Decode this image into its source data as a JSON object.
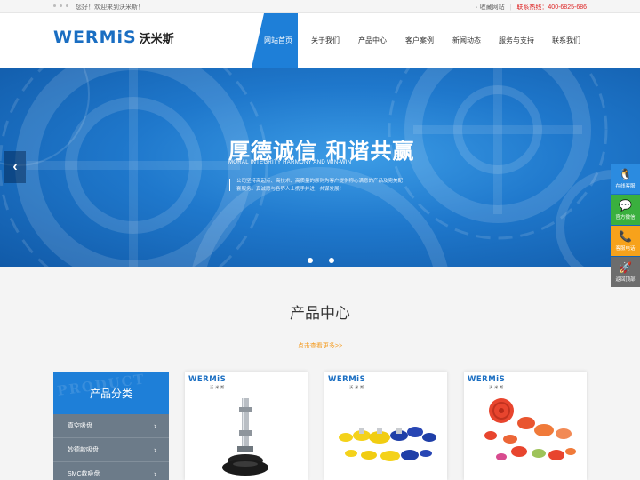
{
  "topbar": {
    "welcome": "您好！欢迎来到沃米斯！",
    "favorite": "收藏网站",
    "hotline_label": "联系热线：",
    "hotline": "400-6825-686"
  },
  "header": {
    "logo_latin": "WERMiS",
    "logo_cn": "沃米斯",
    "nav": [
      {
        "label": "网站首页",
        "active": true
      },
      {
        "label": "关于我们"
      },
      {
        "label": "产品中心"
      },
      {
        "label": "客户案例"
      },
      {
        "label": "新闻动态"
      },
      {
        "label": "服务与支持"
      },
      {
        "label": "联系我们"
      }
    ]
  },
  "banner": {
    "title": "厚德诚信  和谐共赢",
    "subtitle": "MORAL INTEGRITY HARMONY AND WIN-WIN",
    "description": "公司坚持高起点、高技术、高质量的原则为客户提供称心满意的产品及完美配套服务。真诚愿与各界人士携手并进，共谋发展！",
    "prev_arrow": "‹",
    "dots": 2
  },
  "sidebar_float": [
    {
      "icon": "qq-icon",
      "glyph": "🐧",
      "label": "在线客服"
    },
    {
      "icon": "wechat-icon",
      "glyph": "💬",
      "label": "官方微信"
    },
    {
      "icon": "phone-icon",
      "glyph": "📞",
      "label": "客服电话"
    },
    {
      "icon": "rocket-icon",
      "glyph": "🚀",
      "label": "返回顶部"
    }
  ],
  "products_section": {
    "title": "产品中心",
    "more": "点击查看更多>>",
    "category": {
      "title": "产品分类",
      "watermark": "PRODUCT",
      "items": [
        {
          "label": "真空吸盘"
        },
        {
          "label": "妙德款吸盘"
        },
        {
          "label": "SMC款吸盘"
        }
      ]
    },
    "cards": [
      {
        "brand": "WERMiS",
        "brand_cn": "沃米斯"
      },
      {
        "brand": "WERMiS",
        "brand_cn": "沃米斯"
      },
      {
        "brand": "WERMiS",
        "brand_cn": "沃米斯"
      }
    ]
  },
  "colors": {
    "brand_blue": "#1e7fd8",
    "hotline_red": "#dd2222",
    "more_orange": "#f39a1e",
    "category_gray": "#6c7b89"
  }
}
